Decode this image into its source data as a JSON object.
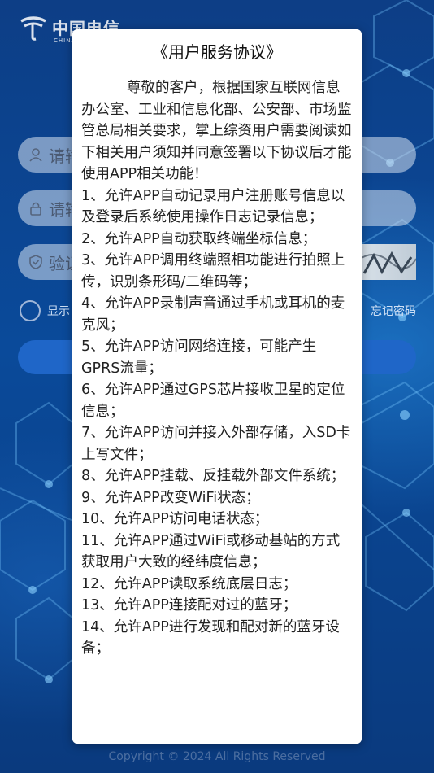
{
  "background": {
    "logo_text": "中国电信",
    "logo_sub": "CHINA TELECOM",
    "username_placeholder": "请输入账号",
    "password_placeholder": "请输入密码",
    "captcha_placeholder": "验证码",
    "remember_label": "显示",
    "forgot_label": "忘记密码",
    "copyright": "Copyright © 2024 All Rights Reserved"
  },
  "dialog": {
    "title": "《用户服务协议》",
    "intro": "尊敬的客户，根据国家互联网信息办公室、工业和信息化部、公安部、市场监管总局相关要求，掌上综资用户需要阅读如下相关用户须知并同意签署以下协议后才能使用APP相关功能！",
    "items": [
      "1、允许APP自动记录用户注册账号信息以及登录后系统使用操作日志记录信息；",
      "2、允许APP自动获取终端坐标信息；",
      "3、允许APP调用终端照相功能进行拍照上传，识别条形码/二维码等；",
      "4、允许APP录制声音通过手机或耳机的麦克风；",
      "5、允许APP访问网络连接，可能产生GPRS流量；",
      "6、允许APP通过GPS芯片接收卫星的定位信息；",
      "7、允许APP访问并接入外部存储，入SD卡上写文件；",
      "8、允许APP挂载、反挂载外部文件系统；",
      "9、允许APP改变WiFi状态；",
      "10、允许APP访问电话状态；",
      "11、允许APP通过WiFi或移动基站的方式获取用户大致的经纬度信息；",
      "12、允许APP读取系统底层日志；",
      "13、允许APP连接配对过的蓝牙；",
      "14、允许APP进行发现和配对新的蓝牙设备；"
    ]
  },
  "colors": {
    "background_blue": "#0b3a78",
    "button_blue": "#1f66c8",
    "dialog_bg": "#ffffff"
  }
}
